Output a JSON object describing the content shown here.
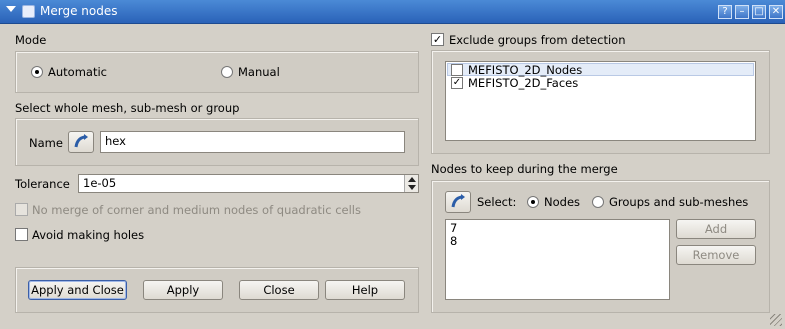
{
  "window": {
    "title": "Merge nodes",
    "help_glyph": "?",
    "min_glyph": "–",
    "max_glyph": "□",
    "close_glyph": "✕"
  },
  "mode": {
    "title": "Mode",
    "automatic": "Automatic",
    "manual": "Manual",
    "selected": "Automatic"
  },
  "mesh_select": {
    "title": "Select whole mesh, sub-mesh or group",
    "name_label": "Name",
    "name_value": "hex"
  },
  "tolerance": {
    "label": "Tolerance",
    "value": "1e-05"
  },
  "options": {
    "no_merge_corner": "No merge of corner and medium nodes of quadratic cells",
    "avoid_holes": "Avoid making holes"
  },
  "buttons": {
    "apply_close": "Apply and Close",
    "apply": "Apply",
    "close": "Close",
    "help": "Help"
  },
  "exclude": {
    "label": "Exclude groups from detection",
    "checked": true,
    "groups": [
      {
        "name": "MEFISTO_2D_Nodes",
        "checked": false
      },
      {
        "name": "MEFISTO_2D_Faces",
        "checked": true
      }
    ]
  },
  "keep": {
    "title": "Nodes to keep during the merge",
    "select_label": "Select:",
    "nodes_option": "Nodes",
    "groups_option": "Groups and sub-meshes",
    "selected": "Nodes",
    "items": [
      "7",
      "8"
    ],
    "add": "Add",
    "remove": "Remove"
  },
  "colors": {
    "titlebar": "#2a62b8",
    "background": "#d4d0c8"
  }
}
